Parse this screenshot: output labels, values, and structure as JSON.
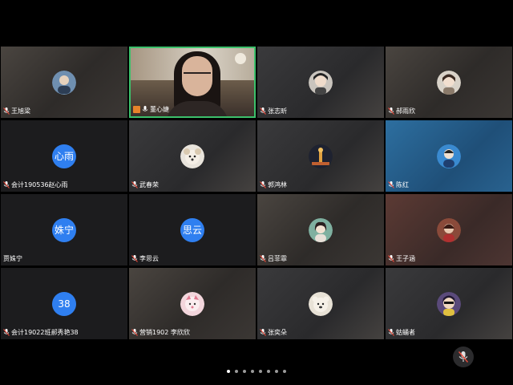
{
  "participants": [
    {
      "name": "王旭梁"
    },
    {
      "name": "董心婕"
    },
    {
      "name": "张志昕"
    },
    {
      "name": "郝雨欣"
    },
    {
      "name": "会计190536赵心雨",
      "avatar_text": "心雨"
    },
    {
      "name": "武春荣"
    },
    {
      "name": "郭鸿林"
    },
    {
      "name": "陈红"
    },
    {
      "name": "贾姝宁",
      "avatar_text": "姝宁"
    },
    {
      "name": "李思云",
      "avatar_text": "思云"
    },
    {
      "name": "吕菲霏"
    },
    {
      "name": "王子涵"
    },
    {
      "name": "会计19022班郝秀艳38",
      "avatar_text": "38"
    },
    {
      "name": "营销1902 李欣欣"
    },
    {
      "name": "张奕朵"
    },
    {
      "name": "蛄蛹者"
    }
  ],
  "pager": {
    "pages": 8,
    "current": 1
  },
  "colors": {
    "active_speaker_border": "#3cc06b",
    "text_avatar_bg": "#2f7ff0",
    "host_badge": "#e8832a"
  }
}
